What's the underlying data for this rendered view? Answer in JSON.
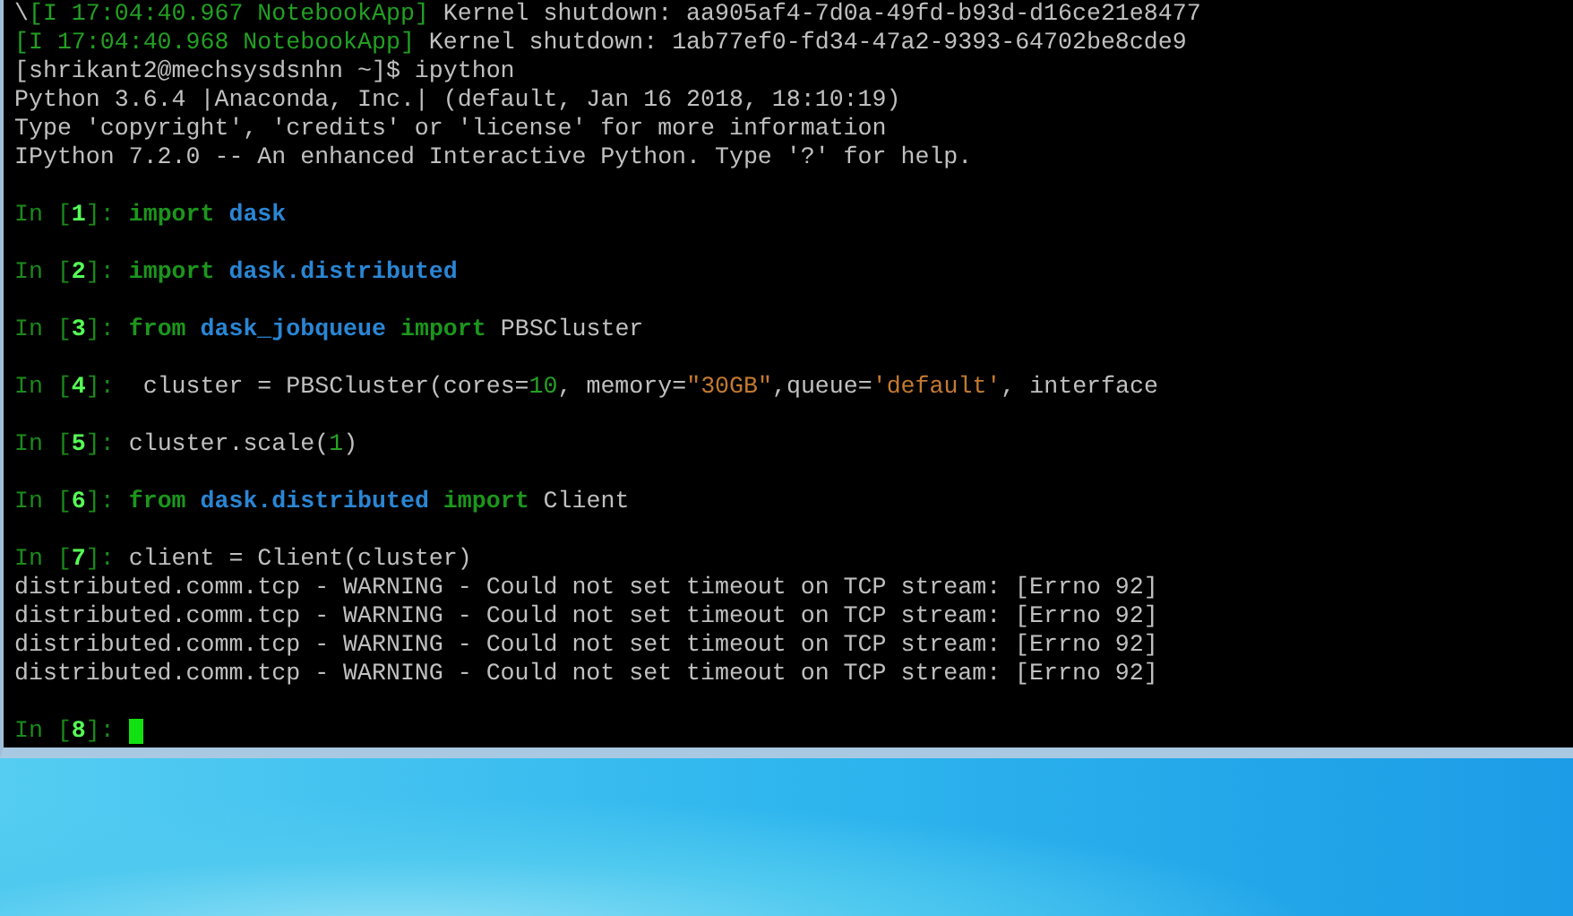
{
  "terminal": {
    "lines": [
      {
        "kind": "output",
        "segments": [
          {
            "text": "\\",
            "kind": "plain"
          },
          {
            "text": "[I 17:04:40.967 NotebookApp]",
            "kind": "log"
          },
          {
            "text": " Kernel shutdown: aa905af4-7d0a-49fd-b93d-d16ce21e8477",
            "kind": "plain"
          }
        ]
      },
      {
        "kind": "output",
        "segments": [
          {
            "text": "[I 17:04:40.968 NotebookApp]",
            "kind": "log"
          },
          {
            "text": " Kernel shutdown: 1ab77ef0-fd34-47a2-9393-64702be8cde9",
            "kind": "plain"
          }
        ]
      },
      {
        "kind": "output",
        "segments": [
          {
            "text": "[shrikant2@mechsysdsnhn ~]$ ipython",
            "kind": "plain"
          }
        ]
      },
      {
        "kind": "output",
        "segments": [
          {
            "text": "Python 3.6.4 |Anaconda, Inc.| (default, Jan 16 2018, 18:10:19)",
            "kind": "plain"
          }
        ]
      },
      {
        "kind": "output",
        "segments": [
          {
            "text": "Type 'copyright', 'credits' or 'license' for more information",
            "kind": "plain"
          }
        ]
      },
      {
        "kind": "output",
        "segments": [
          {
            "text": "IPython 7.2.0 -- An enhanced Interactive Python. Type '?' for help.",
            "kind": "plain"
          }
        ]
      },
      {
        "kind": "blank"
      },
      {
        "kind": "prompt",
        "segments": [
          {
            "text": "In [",
            "kind": "prompt"
          },
          {
            "text": "1",
            "kind": "prompt_number"
          },
          {
            "text": "]: ",
            "kind": "prompt"
          },
          {
            "text": "import ",
            "kind": "keyword"
          },
          {
            "text": "dask",
            "kind": "module"
          }
        ]
      },
      {
        "kind": "blank"
      },
      {
        "kind": "prompt",
        "segments": [
          {
            "text": "In [",
            "kind": "prompt"
          },
          {
            "text": "2",
            "kind": "prompt_number"
          },
          {
            "text": "]: ",
            "kind": "prompt"
          },
          {
            "text": "import ",
            "kind": "keyword"
          },
          {
            "text": "dask.distributed",
            "kind": "module"
          }
        ]
      },
      {
        "kind": "blank"
      },
      {
        "kind": "prompt",
        "segments": [
          {
            "text": "In [",
            "kind": "prompt"
          },
          {
            "text": "3",
            "kind": "prompt_number"
          },
          {
            "text": "]: ",
            "kind": "prompt"
          },
          {
            "text": "from ",
            "kind": "keyword"
          },
          {
            "text": "dask_jobqueue ",
            "kind": "module"
          },
          {
            "text": "import",
            "kind": "keyword"
          },
          {
            "text": " PBSCluster",
            "kind": "plain"
          }
        ]
      },
      {
        "kind": "blank"
      },
      {
        "kind": "prompt",
        "segments": [
          {
            "text": "In [",
            "kind": "prompt"
          },
          {
            "text": "4",
            "kind": "prompt_number"
          },
          {
            "text": "]: ",
            "kind": "prompt"
          },
          {
            "text": " cluster = PBSCluster(cores=",
            "kind": "plain"
          },
          {
            "text": "10",
            "kind": "number"
          },
          {
            "text": ", memory=",
            "kind": "plain"
          },
          {
            "text": "\"30GB\"",
            "kind": "string"
          },
          {
            "text": ",queue=",
            "kind": "plain"
          },
          {
            "text": "'default'",
            "kind": "string"
          },
          {
            "text": ", interface",
            "kind": "plain"
          }
        ]
      },
      {
        "kind": "blank"
      },
      {
        "kind": "prompt",
        "segments": [
          {
            "text": "In [",
            "kind": "prompt"
          },
          {
            "text": "5",
            "kind": "prompt_number"
          },
          {
            "text": "]: ",
            "kind": "prompt"
          },
          {
            "text": "cluster.scale(",
            "kind": "plain"
          },
          {
            "text": "1",
            "kind": "number"
          },
          {
            "text": ")",
            "kind": "plain"
          }
        ]
      },
      {
        "kind": "blank"
      },
      {
        "kind": "prompt",
        "segments": [
          {
            "text": "In [",
            "kind": "prompt"
          },
          {
            "text": "6",
            "kind": "prompt_number"
          },
          {
            "text": "]: ",
            "kind": "prompt"
          },
          {
            "text": "from ",
            "kind": "keyword"
          },
          {
            "text": "dask.distributed ",
            "kind": "module"
          },
          {
            "text": "import",
            "kind": "keyword"
          },
          {
            "text": " Client",
            "kind": "plain"
          }
        ]
      },
      {
        "kind": "blank"
      },
      {
        "kind": "prompt",
        "segments": [
          {
            "text": "In [",
            "kind": "prompt"
          },
          {
            "text": "7",
            "kind": "prompt_number"
          },
          {
            "text": "]: ",
            "kind": "prompt"
          },
          {
            "text": "client = Client(cluster)",
            "kind": "plain"
          }
        ]
      },
      {
        "kind": "output",
        "segments": [
          {
            "text": "distributed.comm.tcp - WARNING - Could not set timeout on TCP stream: [Errno 92]",
            "kind": "plain"
          }
        ]
      },
      {
        "kind": "output",
        "segments": [
          {
            "text": "distributed.comm.tcp - WARNING - Could not set timeout on TCP stream: [Errno 92]",
            "kind": "plain"
          }
        ]
      },
      {
        "kind": "output",
        "segments": [
          {
            "text": "distributed.comm.tcp - WARNING - Could not set timeout on TCP stream: [Errno 92]",
            "kind": "plain"
          }
        ]
      },
      {
        "kind": "output",
        "segments": [
          {
            "text": "distributed.comm.tcp - WARNING - Could not set timeout on TCP stream: [Errno 92]",
            "kind": "plain"
          }
        ]
      },
      {
        "kind": "blank"
      },
      {
        "kind": "prompt",
        "cursor": true,
        "segments": [
          {
            "text": "In [",
            "kind": "prompt"
          },
          {
            "text": "8",
            "kind": "prompt_number"
          },
          {
            "text": "]: ",
            "kind": "prompt"
          }
        ]
      }
    ]
  }
}
